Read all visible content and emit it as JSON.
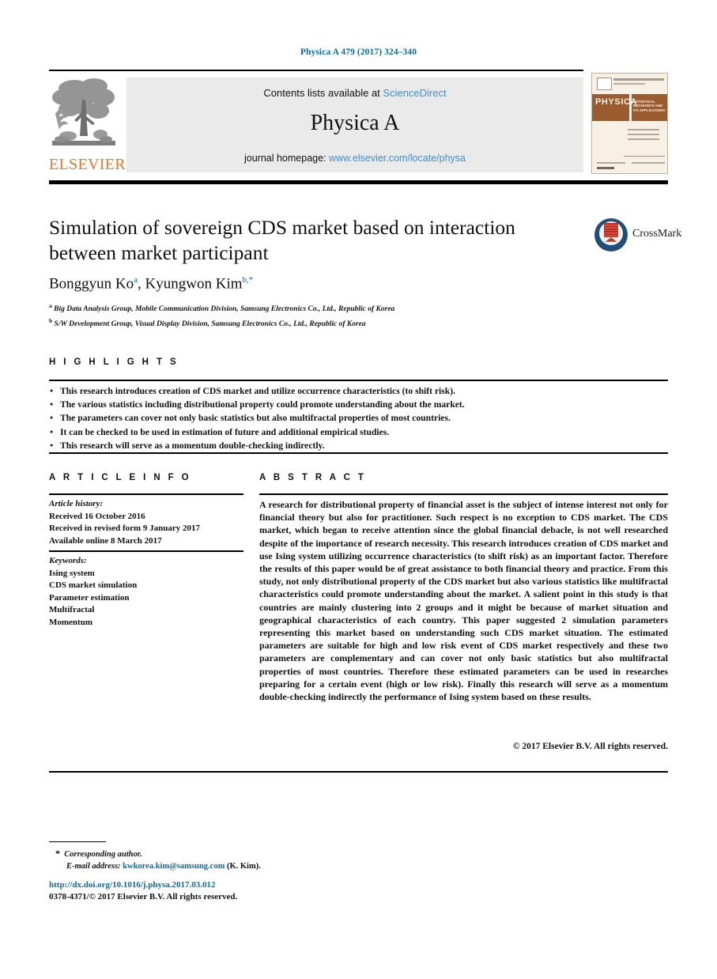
{
  "running_head": "Physica A 479 (2017) 324–340",
  "masthead": {
    "contents_prefix": "Contents lists available at ",
    "contents_link": "ScienceDirect",
    "journal_title": "Physica A",
    "homepage_prefix": "journal homepage: ",
    "homepage_link": "www.elsevier.com/locate/physa",
    "publisher_wordmark": "ELSEVIER",
    "cover_band_label": "PHYSICA",
    "cover_band_sub": "STATISTICAL MECHANICS AND ITS APPLICATIONS"
  },
  "crossmark": {
    "label": "CrossMark"
  },
  "article": {
    "title": "Simulation of sovereign CDS market based on interaction between market participant",
    "author_1": "Bonggyun Ko",
    "author_1_mark": "a",
    "author_separator": ", ",
    "author_2": "Kyungwon Kim",
    "author_2_mark": "b,*",
    "affiliation_a_mark": "a",
    "affiliation_a": "Big Data Analysis Group, Mobile Communication Division, Samsung Electronics Co., Ltd., Republic of Korea",
    "affiliation_b_mark": "b",
    "affiliation_b": "S/W Development Group, Visual Display Division, Samsung Electronics Co., Ltd., Republic of Korea"
  },
  "highlights": {
    "heading": "H I G H L I G H T S",
    "items": [
      "This research introduces creation of CDS market and utilize occurrence characteristics (to shift risk).",
      "The various statistics including distributional property could promote understanding about the market.",
      "The parameters can cover not only basic statistics but also multifractal properties of most countries.",
      "It can be checked to be used in estimation of future and additional empirical studies.",
      "This research will serve as a momentum double-checking indirectly."
    ]
  },
  "article_info": {
    "heading": "A R T I C L E    I N F O",
    "history_label": "Article history:",
    "received": "Received 16 October 2016",
    "revised": "Received in revised form 9 January 2017",
    "available": "Available online 8 March 2017",
    "keywords_label": "Keywords:",
    "keywords": [
      "Ising system",
      "CDS market simulation",
      "Parameter estimation",
      "Multifractal",
      "Momentum"
    ]
  },
  "abstract": {
    "heading": "A B S T R A C T",
    "text": "A research for distributional property of financial asset is the subject of intense interest not only for financial theory but also for practitioner. Such respect is no exception to CDS market. The CDS market, which began to receive attention since the global financial debacle, is not well researched despite of the importance of research necessity. This research introduces creation of CDS market and use Ising system utilizing occurrence characteristics (to shift risk) as an important factor. Therefore the results of this paper would be of great assistance to both financial theory and practice. From this study, not only distributional property of the CDS market but also various statistics like multifractal characteristics could promote understanding about the market. A salient point in this study is that countries are mainly clustering into 2 groups and it might be because of market situation and geographical characteristics of each country. This paper suggested 2 simulation parameters representing this market based on understanding such CDS market situation. The estimated parameters are suitable for high and low risk event of CDS market respectively and these two parameters are complementary and can cover not only basic statistics but also multifractal properties of most countries. Therefore these estimated parameters can be used in researches preparing for a certain event (high or low risk). Finally this research will serve as a momentum double-checking indirectly the performance of Ising system based on these results.",
    "copyright": "© 2017 Elsevier B.V. All rights reserved."
  },
  "footer": {
    "corresponding_star": "*",
    "corresponding_label": "Corresponding author.",
    "email_label": "E-mail address:",
    "email": "kwkorea.kim@samsung.com",
    "email_owner": "(K. Kim).",
    "doi": "http://dx.doi.org/10.1016/j.physa.2017.03.012",
    "issn_line": "0378-4371/© 2017 Elsevier B.V. All rights reserved."
  },
  "colors": {
    "link_blue": "#3f8fd0",
    "header_blue": "#0b6a9c",
    "elsevier_orange": "#e87722",
    "crossmark_blue": "#1f4e79",
    "crossmark_red": "#b5291f"
  }
}
